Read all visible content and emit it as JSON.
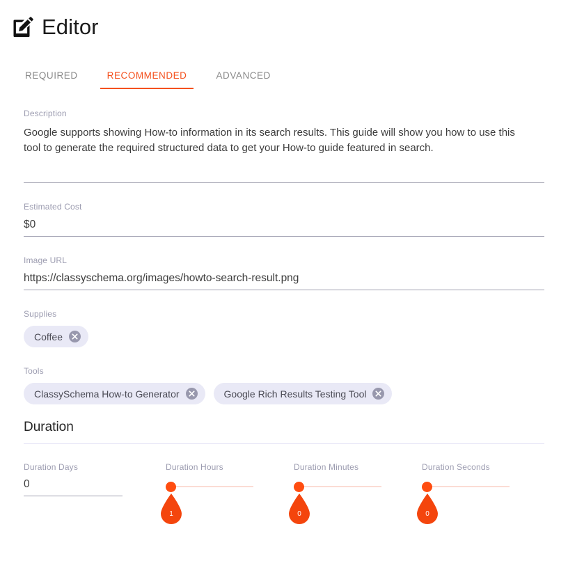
{
  "header": {
    "icon": "edit-square-pencil-icon",
    "title": "Editor"
  },
  "tabs": [
    {
      "label": "REQUIRED",
      "active": false
    },
    {
      "label": "RECOMMENDED",
      "active": true
    },
    {
      "label": "ADVANCED",
      "active": false
    }
  ],
  "fields": {
    "description": {
      "label": "Description",
      "value": "Google supports showing How-to information in its search results. This guide will show you how to use this tool to generate the required structured data to get your How-to guide featured in search."
    },
    "estimated_cost": {
      "label": "Estimated Cost",
      "value": "$0"
    },
    "image_url": {
      "label": "Image URL",
      "value": "https://classyschema.org/images/howto-search-result.png"
    },
    "supplies": {
      "label": "Supplies",
      "chips": [
        {
          "label": "Coffee",
          "remove_icon": "cancel-circle-icon"
        }
      ]
    },
    "tools": {
      "label": "Tools",
      "chips": [
        {
          "label": "ClassySchema How-to Generator",
          "remove_icon": "cancel-circle-icon"
        },
        {
          "label": "Google Rich Results Testing Tool",
          "remove_icon": "cancel-circle-icon"
        }
      ]
    }
  },
  "duration": {
    "section_title": "Duration",
    "days": {
      "label": "Duration Days",
      "value": "0"
    },
    "hours": {
      "label": "Duration Hours",
      "value": "1"
    },
    "minutes": {
      "label": "Duration Minutes",
      "value": "0"
    },
    "seconds": {
      "label": "Duration Seconds",
      "value": "0"
    }
  },
  "colors": {
    "accent": "#f4511e",
    "slider_thumb": "#ff4d10",
    "slider_track": "#fbdcd4",
    "chip_background": "#e9e9f6",
    "label_text": "#9c9cb0"
  }
}
